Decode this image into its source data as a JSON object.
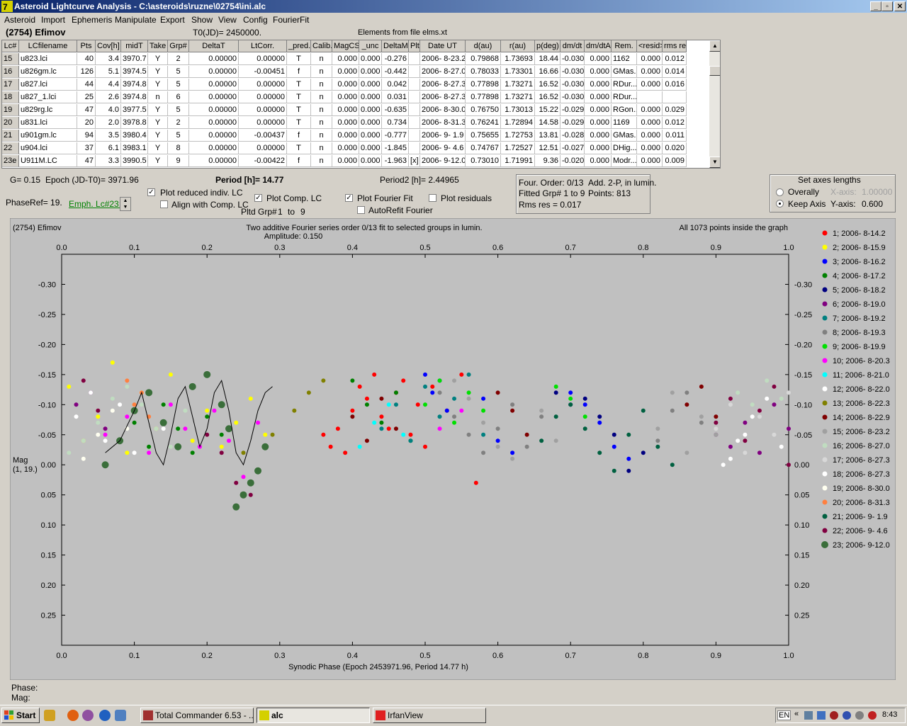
{
  "window": {
    "title": "Asteroid Lightcurve Analysis - C:\\asteroids\\ruzne\\02754\\ini.alc"
  },
  "menu": [
    "Asteroid",
    "Import",
    "Ephemeris",
    "Manipulate",
    "Export",
    "Show",
    "View",
    "Config",
    "FourierFit"
  ],
  "header": {
    "asteroid": "(2754) Efimov",
    "t0": "T0(JD)= 2450000.",
    "elements": "Elements from file elms.xt"
  },
  "table": {
    "columns": [
      "Lc#",
      "LCfilename",
      "Pts",
      "Cov[h]",
      "midT",
      "Take",
      "Grp#",
      "DeltaT",
      "LtCorr.",
      "_pred.",
      "Calib.",
      "MagCS",
      "_unc",
      "DeltaM",
      "Plt",
      "Date UT",
      "d(au)",
      "r(au)",
      "p(deg)",
      "dm/dt",
      "dm/dtA",
      "Rem.",
      "<resid>",
      "rms res"
    ],
    "rows": [
      [
        "15",
        "u823.lci",
        "40",
        "3.4",
        "3970.7",
        "Y",
        "2",
        "0.00000",
        "0.00000",
        "T",
        "n",
        "0.000",
        "0.000",
        "-0.276",
        "",
        "2006- 8-23.2",
        "0.79868",
        "1.73693",
        "18.44",
        "-0.030",
        "0.000",
        "1162",
        "0.000",
        "0.012"
      ],
      [
        "16",
        "u826gm.lc",
        "126",
        "5.1",
        "3974.5",
        "Y",
        "5",
        "0.00000",
        "-0.00451",
        "f",
        "n",
        "0.000",
        "0.000",
        "-0.442",
        "",
        "2006- 8-27.0",
        "0.78033",
        "1.73301",
        "16.66",
        "-0.030",
        "0.000",
        "GMas..",
        "0.000",
        "0.014"
      ],
      [
        "17",
        "u827.lci",
        "44",
        "4.4",
        "3974.8",
        "Y",
        "5",
        "0.00000",
        "0.00000",
        "T",
        "n",
        "0.000",
        "0.000",
        "0.042",
        "",
        "2006- 8-27.3",
        "0.77898",
        "1.73271",
        "16.52",
        "-0.030",
        "0.000",
        "RDur...",
        "0.000",
        "0.016"
      ],
      [
        "18",
        "u827_1.lci",
        "25",
        "2.6",
        "3974.8",
        "n",
        "6",
        "0.00000",
        "0.00000",
        "T",
        "n",
        "0.000",
        "0.000",
        "0.031",
        "",
        "2006- 8-27.3",
        "0.77898",
        "1.73271",
        "16.52",
        "-0.030",
        "0.000",
        "RDur...",
        "",
        ""
      ],
      [
        "19",
        "u829rg.lc",
        "47",
        "4.0",
        "3977.5",
        "Y",
        "5",
        "0.00000",
        "0.00000",
        "T",
        "n",
        "0.000",
        "0.000",
        "-0.635",
        "",
        "2006- 8-30.0",
        "0.76750",
        "1.73013",
        "15.22",
        "-0.029",
        "0.000",
        "RGon..",
        "0.000",
        "0.029"
      ],
      [
        "20",
        "u831.lci",
        "20",
        "2.0",
        "3978.8",
        "Y",
        "2",
        "0.00000",
        "0.00000",
        "T",
        "n",
        "0.000",
        "0.000",
        "0.734",
        "",
        "2006- 8-31.3",
        "0.76241",
        "1.72894",
        "14.58",
        "-0.029",
        "0.000",
        "1169",
        "0.000",
        "0.012"
      ],
      [
        "21",
        "u901gm.lc",
        "94",
        "3.5",
        "3980.4",
        "Y",
        "5",
        "0.00000",
        "-0.00437",
        "f",
        "n",
        "0.000",
        "0.000",
        "-0.777",
        "",
        "2006- 9- 1.9",
        "0.75655",
        "1.72753",
        "13.81",
        "-0.028",
        "0.000",
        "GMas..",
        "0.000",
        "0.011"
      ],
      [
        "22",
        "u904.lci",
        "37",
        "6.1",
        "3983.1",
        "Y",
        "8",
        "0.00000",
        "0.00000",
        "T",
        "n",
        "0.000",
        "0.000",
        "-1.845",
        "",
        "2006- 9- 4.6",
        "0.74767",
        "1.72527",
        "12.51",
        "-0.027",
        "0.000",
        "DHig...",
        "0.000",
        "0.020"
      ],
      [
        "23e",
        "U911M.LC",
        "47",
        "3.3",
        "3990.5",
        "Y",
        "9",
        "0.00000",
        "-0.00422",
        "f",
        "n",
        "0.000",
        "0.000",
        "-1.963",
        "[x]",
        "2006- 9-12.0",
        "0.73010",
        "1.71991",
        "9.36",
        "-0.020",
        "0.000",
        "Modr...",
        "0.000",
        "0.009"
      ]
    ]
  },
  "controls": {
    "g": "G= 0.15",
    "epoch": "Epoch (JD-T0)= 3971.96",
    "period": "Period [h]= 14.77",
    "period2": "Period2 [h]= 2.44965",
    "phaseref": "PhaseRef= 19.",
    "emph": "Emph. Lc#23:",
    "plot_reduced": "Plot reduced indiv. LC",
    "align": "Align with Comp. LC",
    "plot_comp": "Plot Comp. LC",
    "pltd_grp": "Pltd Grp#",
    "grp_from": "1",
    "grp_to_word": "to",
    "grp_to": "9",
    "plot_fourier": "Plot Fourier Fit",
    "plot_resid": "Plot residuals",
    "autorefit": "AutoRefit Fourier",
    "four_order": "Four. Order:  0/13",
    "add2p": "Add. 2-P, in lumin.",
    "fitted": "Fitted Grp# 1 to 9",
    "points": "Points: 813",
    "rms": "Rms res      = 0.017",
    "axes_title": "Set axes lengths",
    "overally": "Overally",
    "keep_axis": "Keep Axis",
    "xaxis_lbl": "X-axis:",
    "xaxis_val": "1.00000",
    "yaxis_lbl": "Y-axis:",
    "yaxis_val": "0.600"
  },
  "chart_data": {
    "type": "scatter",
    "title": "(2754) Efimov",
    "subtitle": "Two additive Fourier series order 0/13 fit to selected groups in lumin.",
    "amplitude": "Amplitude: 0.150",
    "note": "All 1073 points inside the graph",
    "xlabel": "Synodic Phase (Epoch 2453971.96, Period 14.77 h)",
    "ylabel": "Mag",
    "ylabel2": "(1, 19.)",
    "xlim": [
      0,
      1
    ],
    "ylim": [
      -0.35,
      0.3
    ],
    "y_inverted": true,
    "xticks": [
      0.0,
      0.1,
      0.2,
      0.3,
      0.4,
      0.5,
      0.6,
      0.7,
      0.8,
      0.9,
      1.0
    ],
    "xtick_labels": [
      "0.0",
      "0.1",
      "0.2",
      "0.3",
      "0.4",
      "0.5",
      "0.6",
      "0.7",
      "0.8",
      "0.9",
      "1.0"
    ],
    "yticks": [
      -0.3,
      -0.25,
      -0.2,
      -0.15,
      -0.1,
      -0.05,
      0.0,
      0.05,
      0.1,
      0.15,
      0.2,
      0.25
    ],
    "ytick_labels": [
      "-0.30",
      "-0.25",
      "-0.20",
      "-0.15",
      "-0.10",
      "-0.05",
      "0.00",
      "0.05",
      "0.10",
      "0.15",
      "0.20",
      "0.25"
    ],
    "series": [
      {
        "name": "1; 2006- 8-14.2",
        "color": "#ff0000",
        "x": [
          0.36,
          0.37,
          0.38,
          0.39,
          0.4,
          0.41,
          0.42,
          0.43,
          0.44,
          0.45,
          0.46,
          0.47,
          0.48,
          0.49,
          0.5,
          0.51,
          0.53,
          0.55,
          0.57
        ],
        "y": [
          -0.05,
          -0.03,
          -0.06,
          -0.02,
          -0.09,
          -0.13,
          -0.11,
          -0.15,
          -0.08,
          -0.06,
          -0.12,
          -0.14,
          -0.05,
          -0.1,
          -0.03,
          -0.13,
          -0.09,
          -0.15,
          0.03
        ]
      },
      {
        "name": "2; 2006- 8-15.9",
        "color": "#ffff00",
        "x": [
          0.01,
          0.03,
          0.05,
          0.07,
          0.09,
          0.11,
          0.13,
          0.15,
          0.18,
          0.2,
          0.22,
          0.24,
          0.26,
          0.27,
          0.28
        ],
        "y": [
          -0.13,
          -0.04,
          -0.08,
          -0.17,
          -0.02,
          -0.12,
          -0.06,
          -0.15,
          -0.04,
          -0.09,
          -0.03,
          -0.07,
          -0.11,
          0.01,
          -0.05
        ]
      },
      {
        "name": "3; 2006- 8-16.2",
        "color": "#0000ff",
        "x": [
          0.5,
          0.51,
          0.52,
          0.53,
          0.58,
          0.6,
          0.62,
          0.7,
          0.72,
          0.74,
          0.76,
          0.78
        ],
        "y": [
          -0.15,
          -0.12,
          -0.14,
          -0.09,
          -0.11,
          -0.04,
          -0.02,
          -0.12,
          -0.1,
          -0.07,
          -0.03,
          -0.01
        ]
      },
      {
        "name": "4; 2006- 8-17.2",
        "color": "#008000",
        "x": [
          0.08,
          0.1,
          0.12,
          0.14,
          0.16,
          0.18,
          0.2,
          0.22,
          0.4,
          0.42,
          0.44,
          0.46,
          0.48
        ],
        "y": [
          -0.04,
          -0.07,
          -0.03,
          -0.1,
          -0.06,
          -0.02,
          -0.08,
          -0.05,
          -0.14,
          -0.1,
          -0.07,
          -0.12,
          -0.04
        ]
      },
      {
        "name": "5; 2006- 8-18.2",
        "color": "#000080",
        "x": [
          0.68,
          0.7,
          0.72,
          0.74,
          0.76,
          0.78,
          0.8
        ],
        "y": [
          -0.12,
          -0.1,
          -0.11,
          -0.08,
          -0.05,
          0.01,
          -0.02
        ]
      },
      {
        "name": "6; 2006- 8-19.0",
        "color": "#800080",
        "x": [
          0.02,
          0.04,
          0.06,
          0.9,
          0.92,
          0.94,
          0.96,
          0.98,
          1.0
        ],
        "y": [
          -0.1,
          -0.12,
          -0.06,
          -0.05,
          -0.03,
          -0.07,
          -0.02,
          -0.1,
          -0.06
        ]
      },
      {
        "name": "7; 2006- 8-19.2",
        "color": "#008080",
        "x": [
          0.44,
          0.46,
          0.48,
          0.5,
          0.52,
          0.54,
          0.56,
          0.58
        ],
        "y": [
          -0.06,
          -0.1,
          -0.04,
          -0.13,
          -0.08,
          -0.11,
          -0.15,
          -0.05
        ]
      },
      {
        "name": "8; 2006- 8-19.3",
        "color": "#808080",
        "x": [
          0.52,
          0.54,
          0.56,
          0.58,
          0.6,
          0.62,
          0.64,
          0.66,
          0.82,
          0.84,
          0.86,
          0.88
        ],
        "y": [
          -0.12,
          -0.08,
          -0.05,
          -0.02,
          -0.06,
          -0.1,
          -0.03,
          -0.08,
          -0.04,
          -0.09,
          -0.12,
          -0.07
        ]
      },
      {
        "name": "9; 2006- 8-19.9",
        "color": "#00e000",
        "x": [
          0.5,
          0.52,
          0.54,
          0.56,
          0.58,
          0.68,
          0.7,
          0.72
        ],
        "y": [
          -0.1,
          -0.14,
          -0.07,
          -0.12,
          -0.09,
          -0.13,
          -0.11,
          -0.08
        ]
      },
      {
        "name": "10; 2006- 8-20.3",
        "color": "#ff00ff",
        "x": [
          0.06,
          0.09,
          0.12,
          0.15,
          0.17,
          0.19,
          0.21,
          0.23,
          0.25,
          0.27,
          0.52,
          0.55
        ],
        "y": [
          -0.05,
          -0.08,
          -0.02,
          -0.1,
          -0.06,
          -0.03,
          -0.09,
          -0.04,
          0.02,
          -0.07,
          -0.06,
          -0.09
        ]
      },
      {
        "name": "11; 2006- 8-21.0",
        "color": "#00ffff",
        "x": [
          0.41,
          0.43,
          0.45,
          0.47
        ],
        "y": [
          -0.03,
          -0.07,
          -0.1,
          -0.05
        ]
      },
      {
        "name": "12; 2006- 8-22.0",
        "color": "#ffffff",
        "x": [
          0.02,
          0.04,
          0.06,
          0.08,
          0.1,
          0.14,
          0.18,
          0.92,
          0.94,
          0.96,
          0.98
        ],
        "y": [
          -0.08,
          -0.12,
          -0.04,
          -0.1,
          -0.02,
          -0.06,
          -0.13,
          -0.01,
          -0.05,
          -0.09,
          -0.13
        ]
      },
      {
        "name": "13; 2006- 8-22.3",
        "color": "#808000",
        "x": [
          0.25,
          0.27,
          0.29,
          0.32,
          0.34,
          0.36
        ],
        "y": [
          -0.02,
          0.01,
          -0.05,
          -0.09,
          -0.12,
          -0.14
        ]
      },
      {
        "name": "14; 2006- 8-22.9",
        "color": "#800000",
        "x": [
          0.4,
          0.42,
          0.44,
          0.46,
          0.6,
          0.62,
          0.64,
          0.86,
          0.88,
          0.9
        ],
        "y": [
          -0.08,
          -0.04,
          -0.11,
          -0.06,
          -0.12,
          -0.09,
          -0.05,
          -0.1,
          -0.13,
          -0.08
        ]
      },
      {
        "name": "15; 2006- 8-23.2",
        "color": "#a0a0a0",
        "x": [
          0.54,
          0.56,
          0.58,
          0.6,
          0.62,
          0.66,
          0.68,
          0.82,
          0.84,
          0.86,
          0.88,
          0.9
        ],
        "y": [
          -0.14,
          -0.11,
          -0.07,
          -0.03,
          -0.01,
          -0.09,
          -0.04,
          -0.06,
          -0.12,
          -0.02,
          -0.08,
          -0.05
        ]
      },
      {
        "name": "16; 2006- 8-27.0",
        "color": "#c0dcc0",
        "x": [
          0.01,
          0.03,
          0.05,
          0.07,
          0.09,
          0.11,
          0.13,
          0.15,
          0.17,
          0.93,
          0.95,
          0.97,
          0.99
        ],
        "y": [
          -0.02,
          -0.04,
          -0.07,
          -0.11,
          -0.13,
          -0.1,
          -0.06,
          -0.03,
          -0.09,
          -0.12,
          -0.1,
          -0.14,
          -0.11
        ]
      },
      {
        "name": "17; 2006- 8-27.3",
        "color": "#d8d8d8",
        "x": [
          0.9,
          0.92,
          0.94,
          0.96,
          0.98,
          1.0
        ],
        "y": [
          -0.06,
          -0.1,
          -0.02,
          -0.08,
          -0.05,
          -0.12
        ]
      },
      {
        "name": "18; 2006- 8-27.3",
        "color": "#ffffff",
        "x": [
          0.91,
          0.93,
          0.95,
          0.97,
          0.99
        ],
        "y": [
          0.0,
          -0.04,
          -0.08,
          -0.11,
          -0.03
        ]
      },
      {
        "name": "19; 2006- 8-30.0",
        "color": "#fffff0",
        "x": [
          0.03,
          0.05,
          0.07,
          0.09,
          0.11
        ],
        "y": [
          -0.01,
          -0.05,
          -0.09,
          -0.06,
          -0.12
        ]
      },
      {
        "name": "20; 2006- 8-31.3",
        "color": "#ff8040",
        "x": [
          0.09,
          0.1,
          0.11,
          0.12
        ],
        "y": [
          -0.14,
          -0.1,
          -0.12,
          -0.08
        ]
      },
      {
        "name": "21; 2006- 9- 1.9",
        "color": "#006040",
        "x": [
          0.66,
          0.68,
          0.7,
          0.72,
          0.74,
          0.76,
          0.78,
          0.8,
          0.82,
          0.84
        ],
        "y": [
          -0.04,
          -0.08,
          -0.1,
          -0.06,
          -0.02,
          0.01,
          -0.05,
          -0.09,
          -0.03,
          0.0
        ]
      },
      {
        "name": "22; 2006- 9- 4.6",
        "color": "#800040",
        "x": [
          0.03,
          0.05,
          0.2,
          0.22,
          0.24,
          0.26,
          0.9,
          0.92,
          0.94,
          0.96,
          0.98,
          1.0
        ],
        "y": [
          -0.14,
          -0.09,
          -0.05,
          -0.02,
          0.03,
          0.05,
          -0.07,
          -0.11,
          -0.04,
          -0.09,
          -0.13,
          0.0
        ]
      },
      {
        "name": "23; 2006- 9-12.0",
        "color": "#3a6e3a",
        "x": [
          0.06,
          0.08,
          0.1,
          0.12,
          0.14,
          0.16,
          0.18,
          0.2,
          0.22,
          0.23,
          0.24,
          0.25,
          0.26,
          0.27,
          0.28
        ],
        "y": [
          0.0,
          -0.04,
          -0.09,
          -0.12,
          -0.07,
          -0.03,
          -0.13,
          -0.15,
          -0.1,
          -0.06,
          0.07,
          0.05,
          0.03,
          0.01,
          -0.03
        ]
      }
    ],
    "fit_curve": {
      "x": [
        0.06,
        0.08,
        0.1,
        0.11,
        0.12,
        0.13,
        0.14,
        0.15,
        0.16,
        0.17,
        0.18,
        0.19,
        0.2,
        0.21,
        0.22,
        0.23,
        0.24,
        0.25,
        0.26,
        0.27,
        0.28,
        0.29
      ],
      "y": [
        -0.02,
        -0.04,
        -0.09,
        -0.12,
        -0.07,
        -0.02,
        0.0,
        -0.05,
        -0.11,
        -0.13,
        -0.08,
        -0.03,
        -0.06,
        -0.12,
        -0.14,
        -0.09,
        -0.02,
        0.0,
        -0.04,
        -0.09,
        -0.12,
        -0.13
      ]
    }
  },
  "status": {
    "phase": "Phase:",
    "mag": "Mag:"
  },
  "taskbar": {
    "start": "Start",
    "tasks": [
      "Total Commander 6.53 - ...",
      "alc",
      "IrfanView"
    ],
    "lang": "EN",
    "clock": "8:43"
  }
}
